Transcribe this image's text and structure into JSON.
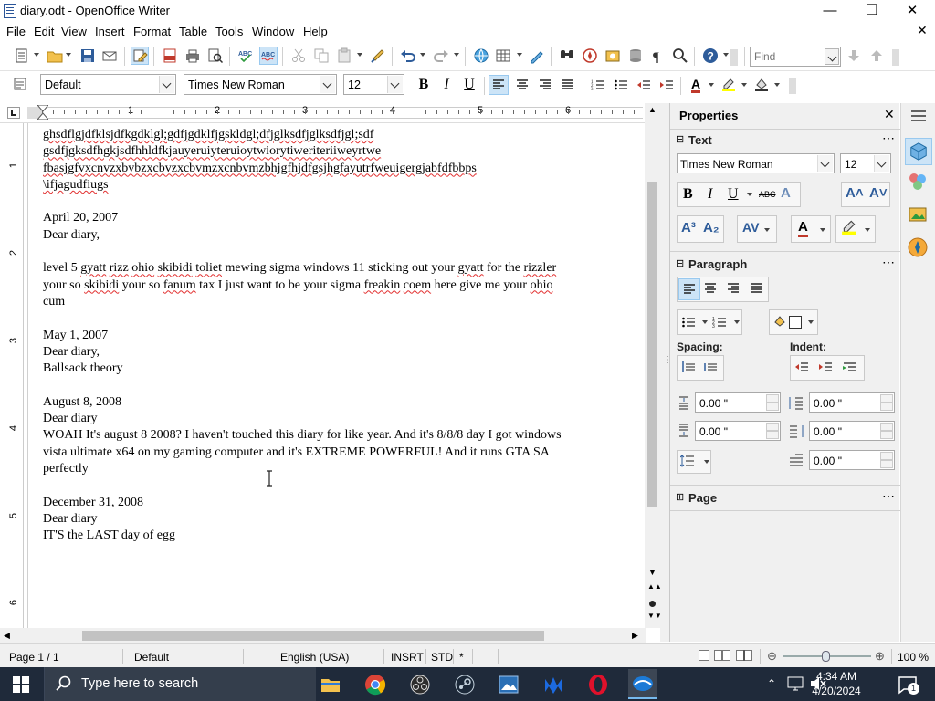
{
  "window": {
    "title": "diary.odt - OpenOffice Writer"
  },
  "menu": [
    "File",
    "Edit",
    "View",
    "Insert",
    "Format",
    "Table",
    "Tools",
    "Window",
    "Help"
  ],
  "find": {
    "placeholder": "Find"
  },
  "format_bar": {
    "style": "Default",
    "font": "Times New Roman",
    "size": "12"
  },
  "ruler": {
    "numbers": [
      "1",
      "2",
      "3",
      "4",
      "5",
      "6"
    ],
    "vnumbers": [
      "1",
      "2",
      "3",
      "4",
      "5",
      "6"
    ]
  },
  "document": {
    "lines": [
      {
        "text": "ghsdflgjdfklsjdfkgdklgl;gdfjgdklfjgskldgl;dfjglksdfjglksdfjgl;sdf",
        "spell": true
      },
      {
        "text": "gsdfjgksdfhgkjsdfhhldfkjauyeruiyteruioytwiorytiweriteriiweyrtwe",
        "spell": true
      },
      {
        "text": "fbasjgfvxcnvzxbvbzxcbvzxcbvmzxcnbvmzbhjgfhjdfgsjhgfayutrfweuigergjabfdfbbps",
        "spell": true
      },
      {
        "text": "\\ifjagudfiugs",
        "spell": true
      },
      {
        "text": "",
        "spell": false
      },
      {
        "text": "April 20, 2007",
        "spell": false
      },
      {
        "text": "Dear diary,",
        "spell": false
      },
      {
        "text": "",
        "spell": false
      },
      {
        "text": "level 5 gyatt rizz ohio skibidi toliet mewing sigma windows 11 sticking out your gyatt for the rizzler",
        "spell": false
      },
      {
        "text": "your so skibidi your so fanum tax I just want to be your sigma freakin coem here give me your ohio",
        "spell": false
      },
      {
        "text": "cum",
        "spell": false
      },
      {
        "text": "",
        "spell": false
      },
      {
        "text": "May 1, 2007",
        "spell": false
      },
      {
        "text": "Dear diary,",
        "spell": false
      },
      {
        "text": "Ballsack theory",
        "spell": false
      },
      {
        "text": "",
        "spell": false
      },
      {
        "text": "August 8, 2008",
        "spell": false
      },
      {
        "text": "Dear diary",
        "spell": false
      },
      {
        "text": "WOAH It's august 8 2008? I haven't touched this diary for like year. And it's 8/8/8 day I got windows",
        "spell": false
      },
      {
        "text": "vista ultimate x64 on my gaming computer and it's EXTREME POWERFUL! And it runs GTA SA",
        "spell": false
      },
      {
        "text": "perfectly",
        "spell": false
      },
      {
        "text": "",
        "spell": false
      },
      {
        "text": "December 31, 2008",
        "spell": false
      },
      {
        "text": "Dear diary",
        "spell": false
      },
      {
        "text": "IT'S the LAST day of egg",
        "spell": false
      }
    ]
  },
  "sidebar": {
    "title": "Properties",
    "text_section": "Text",
    "font": "Times New Roman",
    "size": "12",
    "paragraph_section": "Paragraph",
    "spacing_label": "Spacing:",
    "indent_label": "Indent:",
    "spacing_above": "0.00 \"",
    "spacing_below": "0.00 \"",
    "indent_before": "0.00 \"",
    "indent_after": "0.00 \"",
    "first_line": "0.00 \"",
    "page_section": "Page"
  },
  "status": {
    "page": "Page 1 / 1",
    "style": "Default",
    "language": "English (USA)",
    "mode": "INSRT",
    "selection": "STD",
    "modified": "*",
    "zoom": "100 %"
  },
  "taskbar": {
    "search_placeholder": "Type here to search",
    "time": "4:34 AM",
    "date": "4/20/2024",
    "notification_count": "1"
  },
  "colors": {
    "taskbar_bg": "#1f2a3a",
    "accent": "#0078d7",
    "spell": "#e23030"
  }
}
